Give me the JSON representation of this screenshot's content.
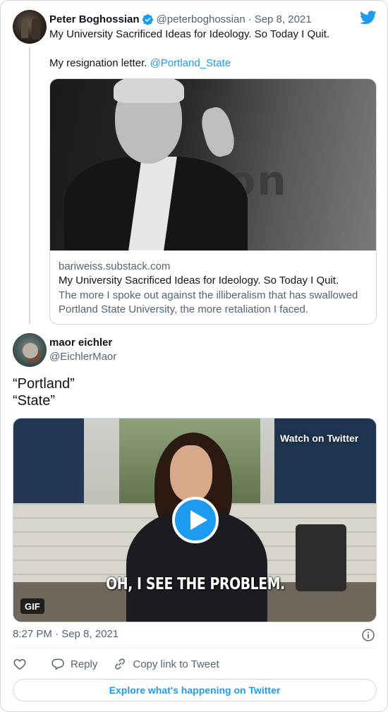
{
  "quoted_tweet": {
    "author_name": "Peter Boghossian",
    "handle": "@peterboghossian",
    "separator": "·",
    "date": "Sep 8, 2021",
    "text_line1": "My University Sacrificed Ideas for Ideology. So Today I Quit.",
    "text_line2": "My resignation letter.",
    "mention": "@Portland_State",
    "link_card": {
      "domain": "bariweiss.substack.com",
      "title": "My University Sacrificed Ideas for Ideology. So Today I Quit.",
      "description_line1": "The more I spoke out against the illiberalism that has swallowed",
      "description_line2": "Portland State University, the more retaliation I faced.",
      "image_text": "son"
    }
  },
  "main_tweet": {
    "author_name": "maor eichler",
    "handle": "@EichlerMaor",
    "text_line1": "“Portland”",
    "text_line2": "“State”",
    "media": {
      "watch_label": "Watch on Twitter",
      "caption": "OH, I SEE THE PROBLEM.",
      "gif_label": "GIF"
    },
    "timestamp": "8:27 PM · Sep 8, 2021"
  },
  "actions": {
    "reply_label": "Reply",
    "copy_link_label": "Copy link to Tweet"
  },
  "explore_label": "Explore what's happening on Twitter",
  "colors": {
    "accent": "#1d9bf0",
    "text_primary": "#0f1419",
    "text_secondary": "#536471",
    "border": "#cfd9de"
  },
  "icons": [
    "verified-badge-icon",
    "twitter-bird-icon",
    "play-icon",
    "info-icon",
    "heart-icon",
    "reply-icon",
    "link-icon"
  ]
}
